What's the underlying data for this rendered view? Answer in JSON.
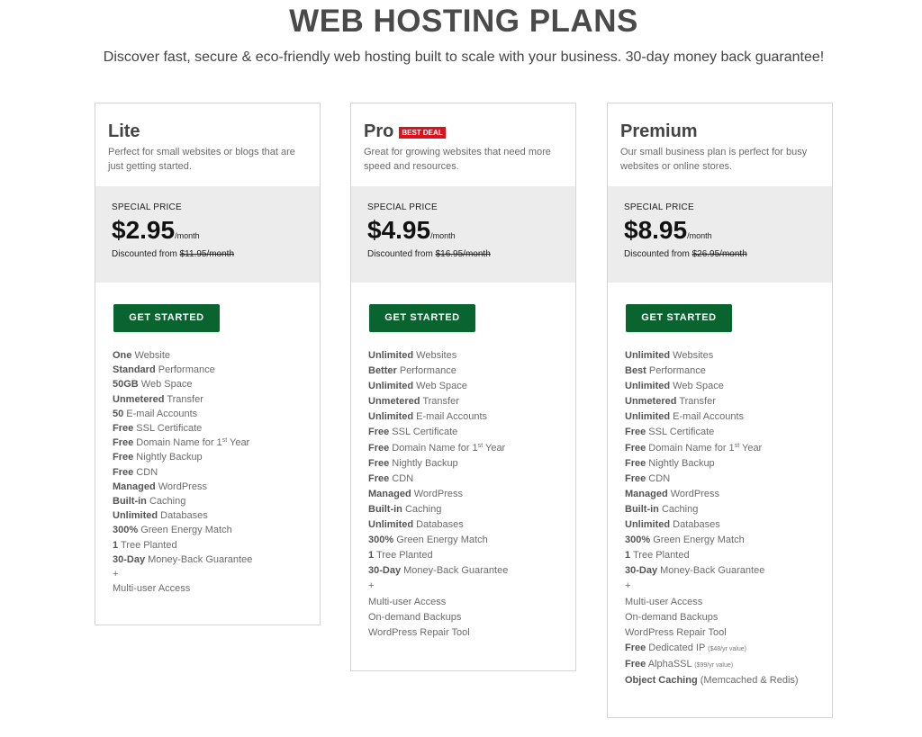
{
  "header": {
    "title": "WEB HOSTING PLANS",
    "subtitle": "Discover fast, secure & eco-friendly web hosting built to scale with your business. 30-day money back guarantee!"
  },
  "colors": {
    "button_green": "#0a6430",
    "badge_red": "#d9121c",
    "price_box_bg": "#ececec"
  },
  "plans": [
    {
      "name": "Lite",
      "badge": null,
      "description": "Perfect for small websites or blogs that are just getting started.",
      "special_label": "SPECIAL PRICE",
      "price": "$2.95",
      "per": "/month",
      "discount_label": "Discounted from",
      "old_price": "$11.95/month",
      "cta": "GET STARTED",
      "features": [
        {
          "bold": "One",
          "text": " Website"
        },
        {
          "bold": "Standard",
          "text": " Performance"
        },
        {
          "bold": "50GB",
          "text": " Web Space"
        },
        {
          "bold": "Unmetered",
          "text": " Transfer"
        },
        {
          "bold": "50",
          "text": " E-mail Accounts"
        },
        {
          "bold": "Free",
          "text": " SSL Certificate"
        },
        {
          "bold": "Free",
          "text": " Domain Name for 1",
          "sup": "st",
          "after": " Year"
        },
        {
          "bold": "Free",
          "text": " Nightly Backup"
        },
        {
          "bold": "Free",
          "text": " CDN"
        },
        {
          "bold": "Managed",
          "text": " WordPress"
        },
        {
          "bold": "Built-in",
          "text": " Caching"
        },
        {
          "bold": "Unlimited",
          "text": " Databases"
        },
        {
          "bold": "300%",
          "text": " Green Energy Match"
        },
        {
          "bold": "1",
          "text": " Tree Planted"
        },
        {
          "bold": "30-Day",
          "text": " Money-Back Guarantee"
        },
        {
          "bold": "",
          "text": "+"
        },
        {
          "bold": "",
          "text": "Multi-user Access"
        }
      ]
    },
    {
      "name": "Pro",
      "badge": "BEST DEAL",
      "description": "Great for growing websites that need more speed and resources.",
      "special_label": "SPECIAL PRICE",
      "price": "$4.95",
      "per": "/month",
      "discount_label": "Discounted from",
      "old_price": "$16.95/month",
      "cta": "GET STARTED",
      "features": [
        {
          "bold": "Unlimited",
          "text": " Websites"
        },
        {
          "bold": "Better",
          "text": " Performance"
        },
        {
          "bold": "Unlimited",
          "text": " Web Space"
        },
        {
          "bold": "Unmetered",
          "text": " Transfer"
        },
        {
          "bold": "Unlimited",
          "text": " E-mail Accounts"
        },
        {
          "bold": "Free",
          "text": " SSL Certificate"
        },
        {
          "bold": "Free",
          "text": " Domain Name for 1",
          "sup": "st",
          "after": " Year"
        },
        {
          "bold": "Free",
          "text": " Nightly Backup"
        },
        {
          "bold": "Free",
          "text": " CDN"
        },
        {
          "bold": "Managed",
          "text": " WordPress"
        },
        {
          "bold": "Built-in",
          "text": " Caching"
        },
        {
          "bold": "Unlimited",
          "text": " Databases"
        },
        {
          "bold": "300%",
          "text": " Green Energy Match"
        },
        {
          "bold": "1",
          "text": " Tree Planted"
        },
        {
          "bold": "30-Day",
          "text": " Money-Back Guarantee"
        },
        {
          "bold": "",
          "text": "+"
        },
        {
          "bold": "",
          "text": "Multi-user Access"
        },
        {
          "bold": "",
          "text": "On-demand Backups"
        },
        {
          "bold": "",
          "text": "WordPress Repair Tool"
        }
      ]
    },
    {
      "name": "Premium",
      "badge": null,
      "description": "Our small business plan is perfect for busy websites or online stores.",
      "special_label": "SPECIAL PRICE",
      "price": "$8.95",
      "per": "/month",
      "discount_label": "Discounted from",
      "old_price": "$26.95/month",
      "cta": "GET STARTED",
      "features": [
        {
          "bold": "Unlimited",
          "text": " Websites"
        },
        {
          "bold": "Best",
          "text": " Performance"
        },
        {
          "bold": "Unlimited",
          "text": " Web Space"
        },
        {
          "bold": "Unmetered",
          "text": " Transfer"
        },
        {
          "bold": "Unlimited",
          "text": " E-mail Accounts"
        },
        {
          "bold": "Free",
          "text": " SSL Certificate"
        },
        {
          "bold": "Free",
          "text": " Domain Name for 1",
          "sup": "st",
          "after": " Year"
        },
        {
          "bold": "Free",
          "text": " Nightly Backup"
        },
        {
          "bold": "Free",
          "text": " CDN"
        },
        {
          "bold": "Managed",
          "text": " WordPress"
        },
        {
          "bold": "Built-in",
          "text": " Caching"
        },
        {
          "bold": "Unlimited",
          "text": " Databases"
        },
        {
          "bold": "300%",
          "text": " Green Energy Match"
        },
        {
          "bold": "1",
          "text": " Tree Planted"
        },
        {
          "bold": "30-Day",
          "text": " Money-Back Guarantee"
        },
        {
          "bold": "",
          "text": "+"
        },
        {
          "bold": "",
          "text": "Multi-user Access"
        },
        {
          "bold": "",
          "text": "On-demand Backups"
        },
        {
          "bold": "",
          "text": "WordPress Repair Tool"
        },
        {
          "bold": "Free",
          "text": " Dedicated IP ",
          "small": "($48/yr value)"
        },
        {
          "bold": "Free",
          "text": " AlphaSSL ",
          "small": "($99/yr value)"
        },
        {
          "bold": "Object Caching",
          "text": " (Memcached & Redis)"
        }
      ]
    }
  ]
}
